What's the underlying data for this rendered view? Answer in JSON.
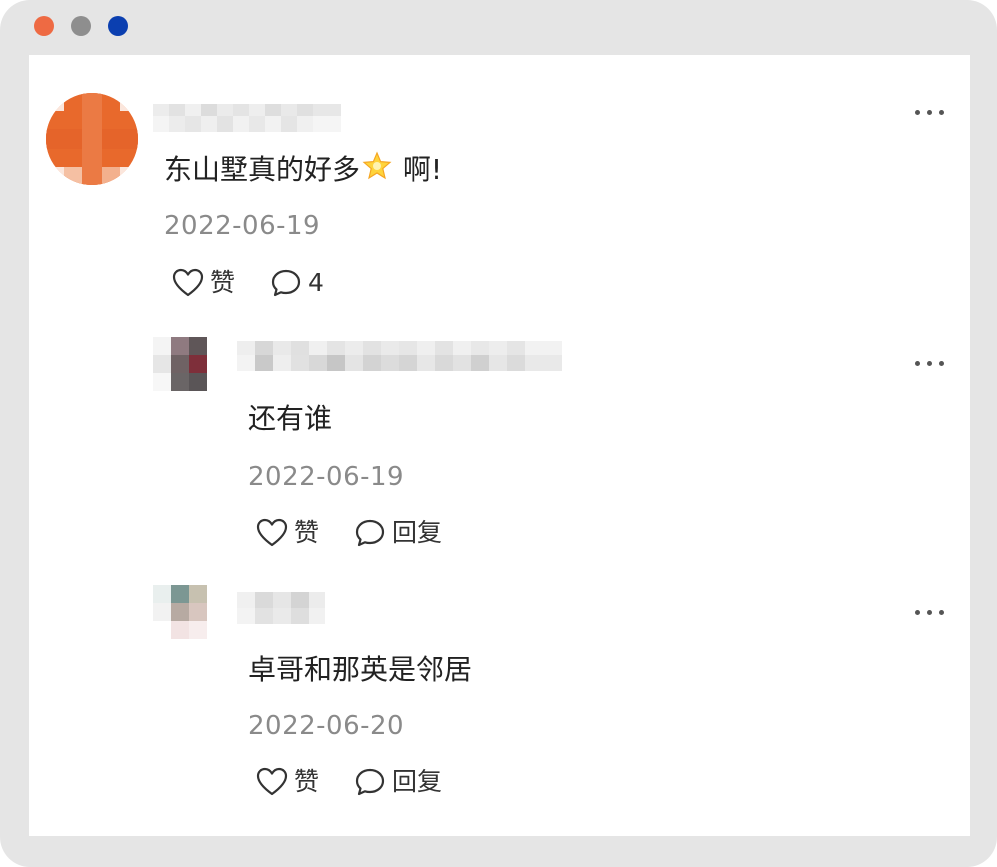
{
  "window": {
    "traffic_lights": [
      "#ee6a43",
      "#8e8e8e",
      "#0b3fb0"
    ]
  },
  "comments": [
    {
      "author_redacted": true,
      "avatar_color": "#e8692c",
      "text": "东山墅真的好多",
      "emoji": "🌟",
      "text_suffix": " 啊!",
      "date": "2022-06-19",
      "like_label": "赞",
      "reply_count": "4"
    },
    {
      "author_redacted": true,
      "text": "还有谁",
      "date": "2022-06-19",
      "like_label": "赞",
      "reply_label": "回复"
    },
    {
      "author_redacted": true,
      "text": "卓哥和那英是邻居",
      "date": "2022-06-20",
      "like_label": "赞",
      "reply_label": "回复"
    }
  ]
}
